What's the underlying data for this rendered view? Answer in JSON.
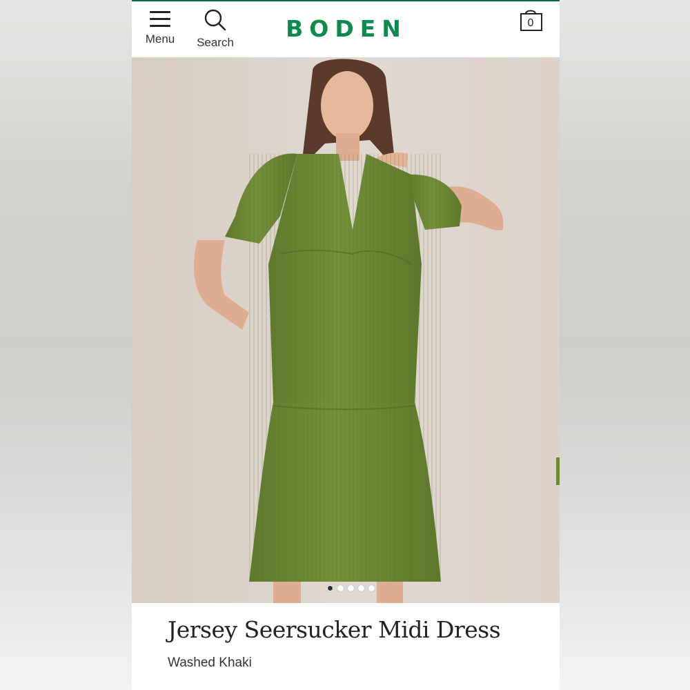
{
  "header": {
    "brand": "BODEN",
    "menu_label": "Menu",
    "search_label": "Search",
    "bag_count": "0",
    "brand_color": "#0f8a4e",
    "accent_line_color": "#0e6b3f"
  },
  "hero": {
    "carousel_total": 5,
    "carousel_active_index": 0
  },
  "product": {
    "name": "Jersey Seersucker Midi Dress",
    "colour": "Washed Khaki"
  }
}
